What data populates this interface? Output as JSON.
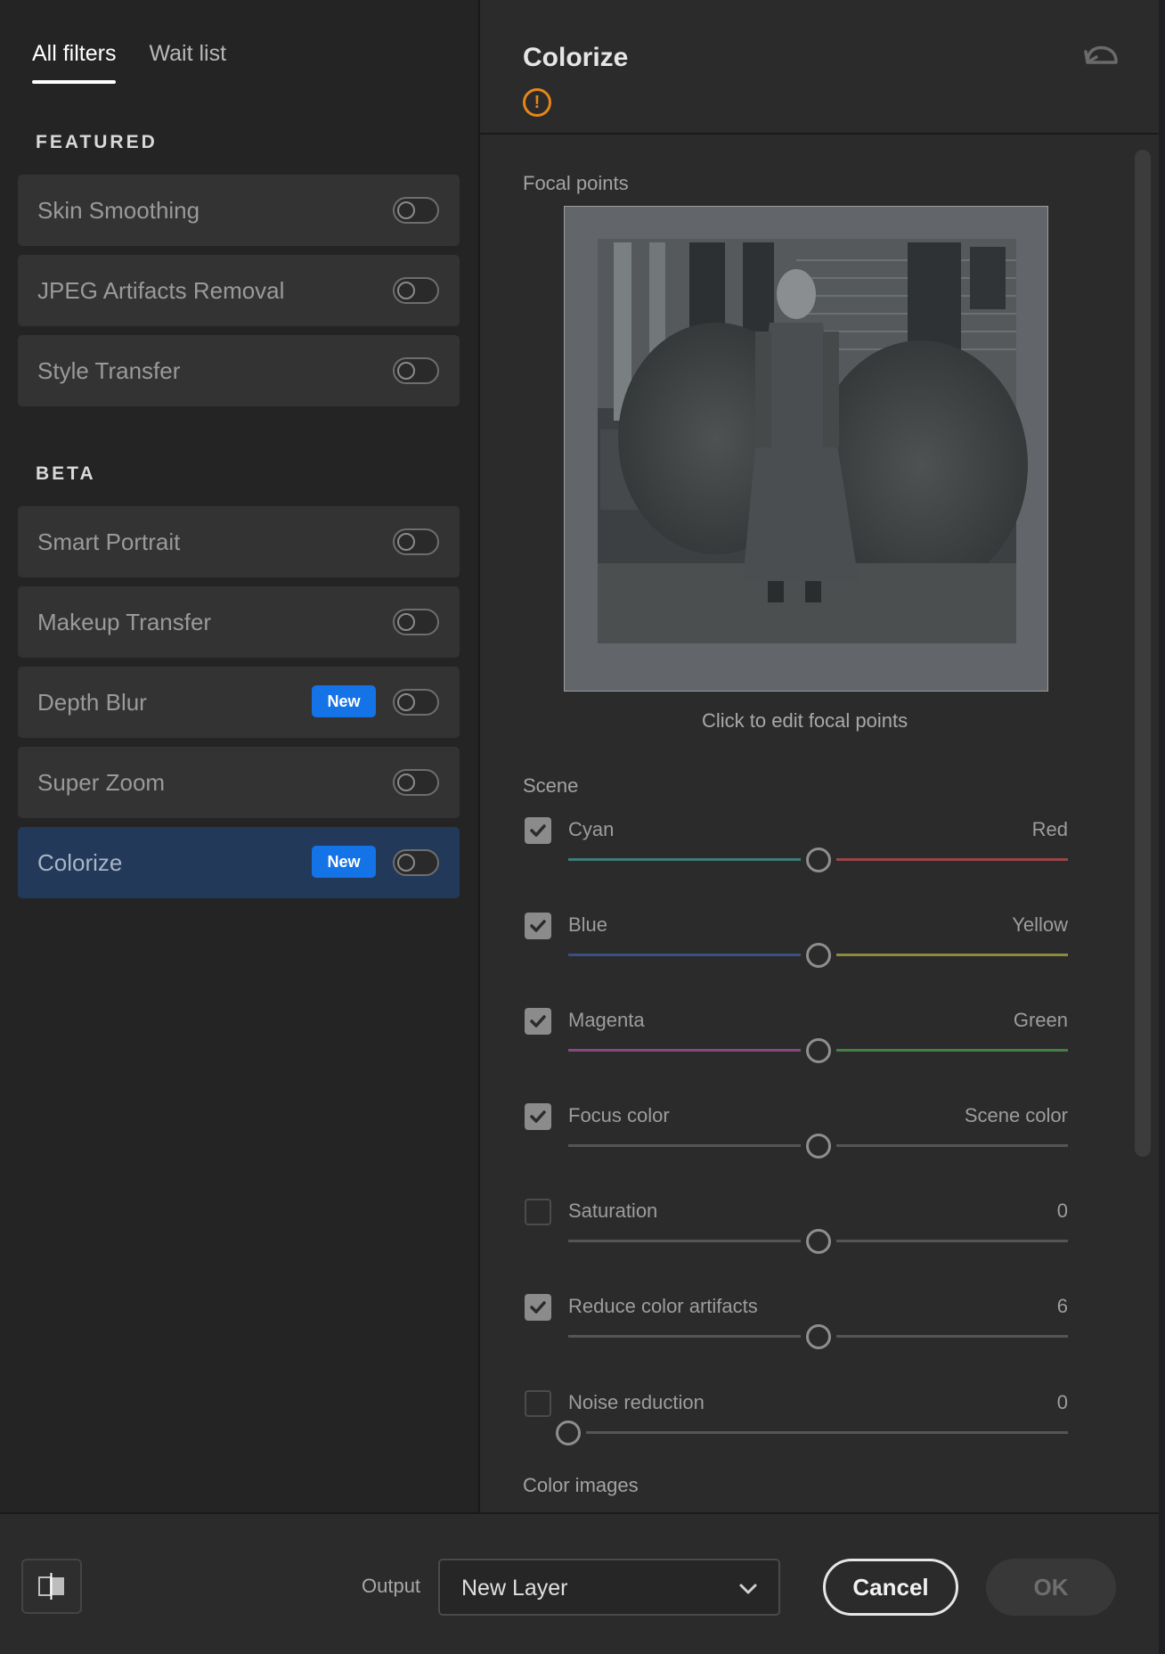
{
  "tabs": [
    {
      "label": "All filters",
      "active": true
    },
    {
      "label": "Wait list",
      "active": false
    }
  ],
  "featured": {
    "title": "FEATURED",
    "items": [
      {
        "label": "Skin Smoothing",
        "enabled": false
      },
      {
        "label": "JPEG Artifacts Removal",
        "enabled": false
      },
      {
        "label": "Style Transfer",
        "enabled": false
      }
    ]
  },
  "beta": {
    "title": "BETA",
    "items": [
      {
        "label": "Smart Portrait",
        "enabled": false
      },
      {
        "label": "Makeup Transfer",
        "enabled": false
      },
      {
        "label": "Depth Blur",
        "badge": "New",
        "enabled": false
      },
      {
        "label": "Super Zoom",
        "enabled": false
      },
      {
        "label": "Colorize",
        "badge": "New",
        "enabled": false,
        "selected": true
      }
    ]
  },
  "panel": {
    "title": "Colorize",
    "warning_icon": "alert-circle-icon",
    "reset_icon": "undo-icon",
    "focal_points_label": "Focal points",
    "focal_caption": "Click to edit focal points",
    "scene_label": "Scene",
    "color_images_label": "Color images"
  },
  "sliders": [
    {
      "left": "Cyan",
      "right": "Red",
      "checked": true,
      "position": 0.5,
      "colors": [
        "#3e7c78",
        "#9a4444"
      ]
    },
    {
      "left": "Blue",
      "right": "Yellow",
      "checked": true,
      "position": 0.5,
      "colors": [
        "#3b4f86",
        "#8c8c3a"
      ]
    },
    {
      "left": "Magenta",
      "right": "Green",
      "checked": true,
      "position": 0.5,
      "colors": [
        "#864a80",
        "#467f45"
      ]
    },
    {
      "left": "Focus color",
      "right": "Scene color",
      "checked": true,
      "position": 0.5,
      "colors": [
        "#555555",
        "#555555"
      ]
    },
    {
      "left": "Saturation",
      "right": "0",
      "checked": false,
      "position": 0.5,
      "colors": [
        "#555555",
        "#555555"
      ]
    },
    {
      "left": "Reduce color artifacts",
      "right": "6",
      "checked": true,
      "position": 0.5,
      "colors": [
        "#555555",
        "#555555"
      ]
    },
    {
      "left": "Noise reduction",
      "right": "0",
      "checked": false,
      "position": 0.0,
      "colors": [
        "#555555",
        "#555555"
      ]
    }
  ],
  "footer": {
    "compare_icon": "split-view-icon",
    "output_label": "Output",
    "output_value": "New Layer",
    "cancel_label": "Cancel",
    "ok_label": "OK"
  },
  "colors": {
    "accent": "#1473e6",
    "selected_row": "#22395a",
    "warning": "#e68619"
  }
}
